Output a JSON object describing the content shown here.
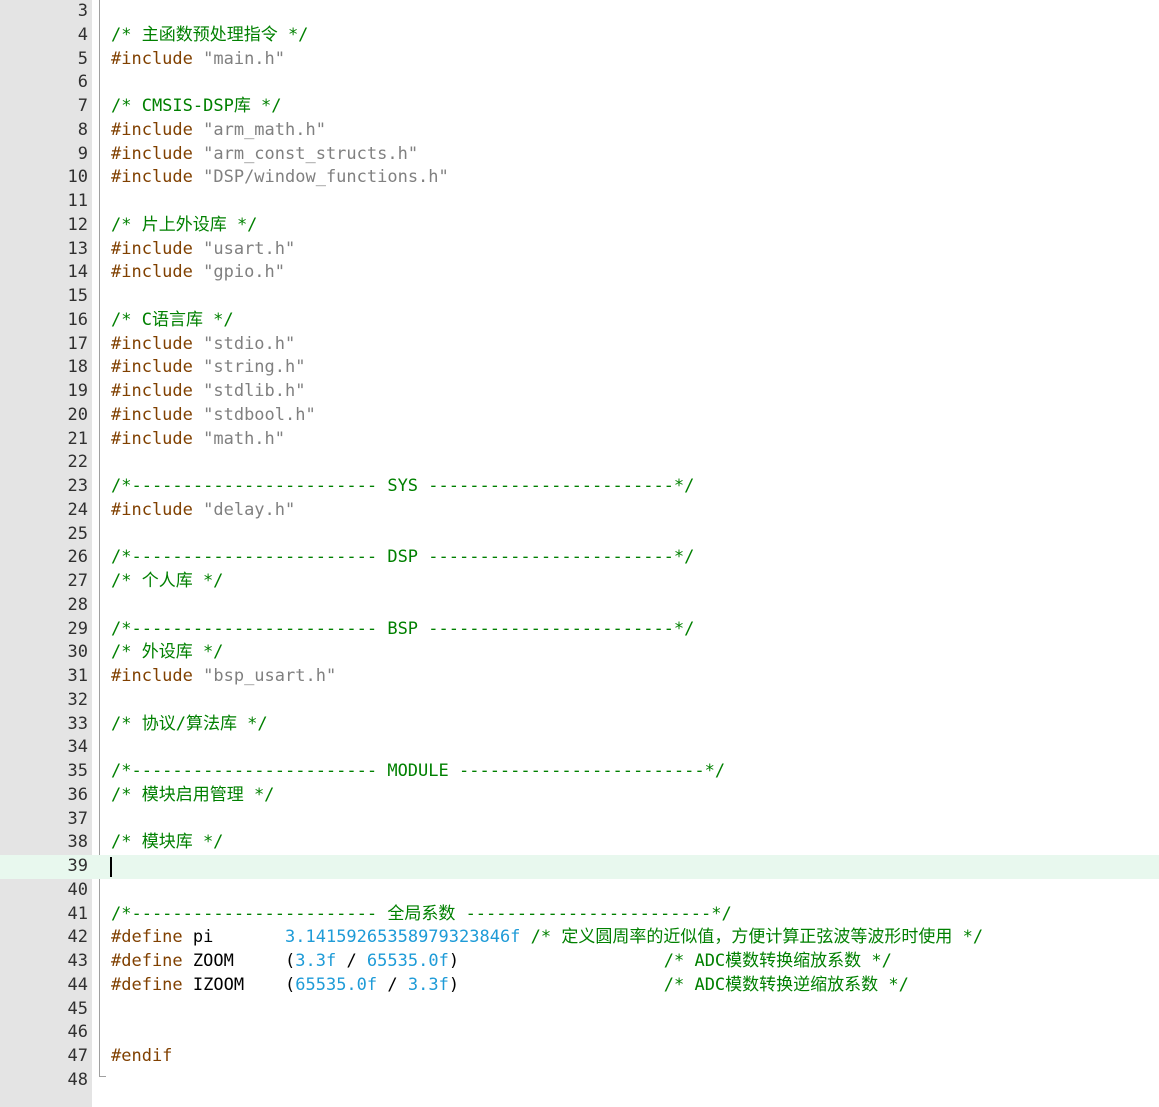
{
  "editor": {
    "colors": {
      "gutter_bg": "#e4e4e4",
      "current_line_bg": "#e8f8ee",
      "comment": "#008000",
      "preprocessor": "#804000",
      "string": "#808080",
      "number": "#1e9bd7"
    },
    "current_line": 39,
    "lines": [
      {
        "n": "3",
        "tokens": []
      },
      {
        "n": "4",
        "tokens": [
          {
            "t": "comment",
            "v": "/* 主函数预处理指令 */"
          }
        ]
      },
      {
        "n": "5",
        "tokens": [
          {
            "t": "pre",
            "v": "#include "
          },
          {
            "t": "str",
            "v": "\"main.h\""
          }
        ]
      },
      {
        "n": "6",
        "tokens": []
      },
      {
        "n": "7",
        "tokens": [
          {
            "t": "comment",
            "v": "/* CMSIS-DSP库 */"
          }
        ]
      },
      {
        "n": "8",
        "tokens": [
          {
            "t": "pre",
            "v": "#include "
          },
          {
            "t": "str",
            "v": "\"arm_math.h\""
          }
        ]
      },
      {
        "n": "9",
        "tokens": [
          {
            "t": "pre",
            "v": "#include "
          },
          {
            "t": "str",
            "v": "\"arm_const_structs.h\""
          }
        ]
      },
      {
        "n": "10",
        "tokens": [
          {
            "t": "pre",
            "v": "#include "
          },
          {
            "t": "str",
            "v": "\"DSP/window_functions.h\""
          }
        ]
      },
      {
        "n": "11",
        "tokens": []
      },
      {
        "n": "12",
        "tokens": [
          {
            "t": "comment",
            "v": "/* 片上外设库 */"
          }
        ]
      },
      {
        "n": "13",
        "tokens": [
          {
            "t": "pre",
            "v": "#include "
          },
          {
            "t": "str",
            "v": "\"usart.h\""
          }
        ]
      },
      {
        "n": "14",
        "tokens": [
          {
            "t": "pre",
            "v": "#include "
          },
          {
            "t": "str",
            "v": "\"gpio.h\""
          }
        ]
      },
      {
        "n": "15",
        "tokens": []
      },
      {
        "n": "16",
        "tokens": [
          {
            "t": "comment",
            "v": "/* C语言库 */"
          }
        ]
      },
      {
        "n": "17",
        "tokens": [
          {
            "t": "pre",
            "v": "#include "
          },
          {
            "t": "str",
            "v": "\"stdio.h\""
          }
        ]
      },
      {
        "n": "18",
        "tokens": [
          {
            "t": "pre",
            "v": "#include "
          },
          {
            "t": "str",
            "v": "\"string.h\""
          }
        ]
      },
      {
        "n": "19",
        "tokens": [
          {
            "t": "pre",
            "v": "#include "
          },
          {
            "t": "str",
            "v": "\"stdlib.h\""
          }
        ]
      },
      {
        "n": "20",
        "tokens": [
          {
            "t": "pre",
            "v": "#include "
          },
          {
            "t": "str",
            "v": "\"stdbool.h\""
          }
        ]
      },
      {
        "n": "21",
        "tokens": [
          {
            "t": "pre",
            "v": "#include "
          },
          {
            "t": "str",
            "v": "\"math.h\""
          }
        ]
      },
      {
        "n": "22",
        "tokens": []
      },
      {
        "n": "23",
        "tokens": [
          {
            "t": "comment",
            "v": "/*------------------------ SYS ------------------------*/"
          }
        ]
      },
      {
        "n": "24",
        "tokens": [
          {
            "t": "pre",
            "v": "#include "
          },
          {
            "t": "str",
            "v": "\"delay.h\""
          }
        ]
      },
      {
        "n": "25",
        "tokens": []
      },
      {
        "n": "26",
        "tokens": [
          {
            "t": "comment",
            "v": "/*------------------------ DSP ------------------------*/"
          }
        ]
      },
      {
        "n": "27",
        "tokens": [
          {
            "t": "comment",
            "v": "/* 个人库 */"
          }
        ]
      },
      {
        "n": "28",
        "tokens": []
      },
      {
        "n": "29",
        "tokens": [
          {
            "t": "comment",
            "v": "/*------------------------ BSP ------------------------*/"
          }
        ]
      },
      {
        "n": "30",
        "tokens": [
          {
            "t": "comment",
            "v": "/* 外设库 */"
          }
        ]
      },
      {
        "n": "31",
        "tokens": [
          {
            "t": "pre",
            "v": "#include "
          },
          {
            "t": "str",
            "v": "\"bsp_usart.h\""
          }
        ]
      },
      {
        "n": "32",
        "tokens": []
      },
      {
        "n": "33",
        "tokens": [
          {
            "t": "comment",
            "v": "/* 协议/算法库 */"
          }
        ]
      },
      {
        "n": "34",
        "tokens": []
      },
      {
        "n": "35",
        "tokens": [
          {
            "t": "comment",
            "v": "/*------------------------ MODULE ------------------------*/"
          }
        ]
      },
      {
        "n": "36",
        "tokens": [
          {
            "t": "comment",
            "v": "/* 模块启用管理 */"
          }
        ]
      },
      {
        "n": "37",
        "tokens": []
      },
      {
        "n": "38",
        "tokens": [
          {
            "t": "comment",
            "v": "/* 模块库 */"
          }
        ]
      },
      {
        "n": "39",
        "tokens": []
      },
      {
        "n": "40",
        "tokens": []
      },
      {
        "n": "41",
        "tokens": [
          {
            "t": "comment",
            "v": "/*------------------------ 全局系数 ------------------------*/"
          }
        ]
      },
      {
        "n": "42",
        "tokens": [
          {
            "t": "pre",
            "v": "#define "
          },
          {
            "t": "plain",
            "v": "pi       "
          },
          {
            "t": "num",
            "v": "3.14159265358979323846f"
          },
          {
            "t": "plain",
            "v": " "
          },
          {
            "t": "comment",
            "v": "/* 定义圆周率的近似值，方便计算正弦波等波形时使用 */"
          }
        ]
      },
      {
        "n": "43",
        "tokens": [
          {
            "t": "pre",
            "v": "#define "
          },
          {
            "t": "plain",
            "v": "ZOOM     ("
          },
          {
            "t": "num",
            "v": "3.3f"
          },
          {
            "t": "plain",
            "v": " / "
          },
          {
            "t": "num",
            "v": "65535.0f"
          },
          {
            "t": "plain",
            "v": ")                    "
          },
          {
            "t": "comment",
            "v": "/* ADC模数转换缩放系数 */"
          }
        ]
      },
      {
        "n": "44",
        "tokens": [
          {
            "t": "pre",
            "v": "#define "
          },
          {
            "t": "plain",
            "v": "IZOOM    ("
          },
          {
            "t": "num",
            "v": "65535.0f"
          },
          {
            "t": "plain",
            "v": " / "
          },
          {
            "t": "num",
            "v": "3.3f"
          },
          {
            "t": "plain",
            "v": ")                    "
          },
          {
            "t": "comment",
            "v": "/* ADC模数转换逆缩放系数 */"
          }
        ]
      },
      {
        "n": "45",
        "tokens": []
      },
      {
        "n": "46",
        "tokens": []
      },
      {
        "n": "47",
        "tokens": [
          {
            "t": "pre",
            "v": "#endif"
          }
        ]
      },
      {
        "n": "48",
        "tokens": []
      }
    ]
  }
}
